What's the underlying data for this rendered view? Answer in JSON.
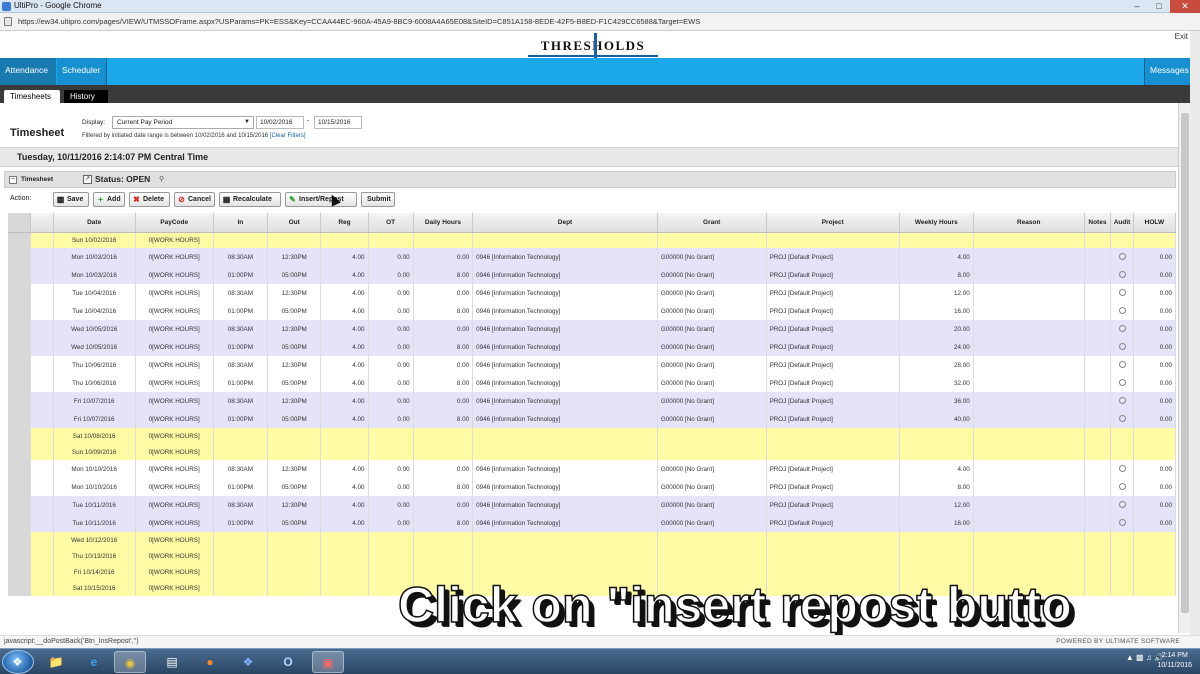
{
  "window": {
    "title": "UltiPro - Google Chrome",
    "url": "https://ew34.ultipro.com/pages/VIEW/UTMSSOFrame.aspx?USParams=PK=ESS&Key=CCAA44EC-960A-45A9-8BC9-6008A4A65E08&SiteID=C851A158-8EDE-42F5-B8ED-F1C429CC6588&Target=EWS"
  },
  "header": {
    "logo": "THRESHOLDS",
    "exit": "Exit"
  },
  "nav": {
    "attendance": "Attendance",
    "scheduler": "Scheduler",
    "messages": "Messages"
  },
  "tabs": {
    "timesheets": "Timesheets",
    "history": "History"
  },
  "filter": {
    "title": "Timesheet",
    "display_label": "Display:",
    "display_value": "Current Pay Period",
    "start": "10/02/2016",
    "end": "10/15/2016",
    "dash": "-",
    "note": "Filtered by initiated date range is between 10/02/2016 and 10/15/2016",
    "clear": "[Clear Filters]"
  },
  "dateline": "Tuesday, 10/11/2016 2:14:07 PM Central Time",
  "sheet": {
    "label": "Timesheet",
    "status": "Status: OPEN"
  },
  "actions": {
    "label": "Action:",
    "save": "Save",
    "add": "Add",
    "delete": "Delete",
    "cancel": "Cancel",
    "recalculate": "Recalculate",
    "insert_repost": "Insert/Repost",
    "submit": "Submit"
  },
  "columns": [
    "",
    "",
    "Date",
    "PayCode",
    "In",
    "Out",
    "Reg",
    "OT",
    "Daily Hours",
    "Dept",
    "Grant",
    "Project",
    "Weekly Hours",
    "Reason",
    "Notes",
    "Audit",
    "HOLW"
  ],
  "rows": [
    {
      "type": "yellow",
      "date": "Sun 10/02/2016",
      "paycode": "0[WORK HOURS]",
      "in": "",
      "out": "",
      "reg": "",
      "ot": "",
      "daily": "",
      "dept": "",
      "grant": "",
      "project": "",
      "weekly": "",
      "audit": false,
      "holw": ""
    },
    {
      "type": "purple",
      "date": "Mon 10/03/2016",
      "paycode": "0[WORK HOURS]",
      "in": "08:30AM",
      "out": "12:30PM",
      "reg": "4.00",
      "ot": "0.00",
      "daily": "0.00",
      "dept": "0946 [Information Technology]",
      "grant": "G00000 [No Grant]",
      "project": "PROJ [Default Project]",
      "weekly": "4.00",
      "audit": true,
      "holw": "0.00"
    },
    {
      "type": "purple",
      "date": "Mon 10/03/2016",
      "paycode": "0[WORK HOURS]",
      "in": "01:00PM",
      "out": "05:00PM",
      "reg": "4.00",
      "ot": "0.00",
      "daily": "8.00",
      "dept": "0946 [Information Technology]",
      "grant": "G00000 [No Grant]",
      "project": "PROJ [Default Project]",
      "weekly": "8.00",
      "audit": true,
      "holw": "0.00"
    },
    {
      "type": "white",
      "date": "Tue 10/04/2016",
      "paycode": "0[WORK HOURS]",
      "in": "08:30AM",
      "out": "12:30PM",
      "reg": "4.00",
      "ot": "0.00",
      "daily": "0.00",
      "dept": "0946 [Information Technology]",
      "grant": "G00000 [No Grant]",
      "project": "PROJ [Default Project]",
      "weekly": "12.00",
      "audit": true,
      "holw": "0.00"
    },
    {
      "type": "white",
      "date": "Tue 10/04/2016",
      "paycode": "0[WORK HOURS]",
      "in": "01:00PM",
      "out": "05:00PM",
      "reg": "4.00",
      "ot": "0.00",
      "daily": "8.00",
      "dept": "0946 [Information Technology]",
      "grant": "G00000 [No Grant]",
      "project": "PROJ [Default Project]",
      "weekly": "16.00",
      "audit": true,
      "holw": "0.00"
    },
    {
      "type": "purple",
      "date": "Wed 10/05/2016",
      "paycode": "0[WORK HOURS]",
      "in": "08:30AM",
      "out": "12:30PM",
      "reg": "4.00",
      "ot": "0.00",
      "daily": "0.00",
      "dept": "0946 [Information Technology]",
      "grant": "G00000 [No Grant]",
      "project": "PROJ [Default Project]",
      "weekly": "20.00",
      "audit": true,
      "holw": "0.00"
    },
    {
      "type": "purple",
      "date": "Wed 10/05/2016",
      "paycode": "0[WORK HOURS]",
      "in": "01:00PM",
      "out": "05:00PM",
      "reg": "4.00",
      "ot": "0.00",
      "daily": "8.00",
      "dept": "0946 [Information Technology]",
      "grant": "G00000 [No Grant]",
      "project": "PROJ [Default Project]",
      "weekly": "24.00",
      "audit": true,
      "holw": "0.00"
    },
    {
      "type": "white",
      "date": "Thu 10/06/2016",
      "paycode": "0[WORK HOURS]",
      "in": "08:30AM",
      "out": "12:30PM",
      "reg": "4.00",
      "ot": "0.00",
      "daily": "0.00",
      "dept": "0946 [Information Technology]",
      "grant": "G00000 [No Grant]",
      "project": "PROJ [Default Project]",
      "weekly": "28.00",
      "audit": true,
      "holw": "0.00"
    },
    {
      "type": "white",
      "date": "Thu 10/06/2016",
      "paycode": "0[WORK HOURS]",
      "in": "01:00PM",
      "out": "05:00PM",
      "reg": "4.00",
      "ot": "0.00",
      "daily": "8.00",
      "dept": "0946 [Information Technology]",
      "grant": "G00000 [No Grant]",
      "project": "PROJ [Default Project]",
      "weekly": "32.00",
      "audit": true,
      "holw": "0.00"
    },
    {
      "type": "purple",
      "date": "Fri 10/07/2016",
      "paycode": "0[WORK HOURS]",
      "in": "08:30AM",
      "out": "12:30PM",
      "reg": "4.00",
      "ot": "0.00",
      "daily": "0.00",
      "dept": "0946 [Information Technology]",
      "grant": "G00000 [No Grant]",
      "project": "PROJ [Default Project]",
      "weekly": "36.00",
      "audit": true,
      "holw": "0.00"
    },
    {
      "type": "purple",
      "date": "Fri 10/07/2016",
      "paycode": "0[WORK HOURS]",
      "in": "01:00PM",
      "out": "05:00PM",
      "reg": "4.00",
      "ot": "0.00",
      "daily": "8.00",
      "dept": "0946 [Information Technology]",
      "grant": "G00000 [No Grant]",
      "project": "PROJ [Default Project]",
      "weekly": "40.00",
      "audit": true,
      "holw": "0.00"
    },
    {
      "type": "yellow",
      "date": "Sat 10/08/2016",
      "paycode": "0[WORK HOURS]",
      "in": "",
      "out": "",
      "reg": "",
      "ot": "",
      "daily": "",
      "dept": "",
      "grant": "",
      "project": "",
      "weekly": "",
      "audit": false,
      "holw": ""
    },
    {
      "type": "yellow",
      "date": "Sun 10/09/2016",
      "paycode": "0[WORK HOURS]",
      "in": "",
      "out": "",
      "reg": "",
      "ot": "",
      "daily": "",
      "dept": "",
      "grant": "",
      "project": "",
      "weekly": "",
      "audit": false,
      "holw": ""
    },
    {
      "type": "white",
      "date": "Mon 10/10/2016",
      "paycode": "0[WORK HOURS]",
      "in": "08:30AM",
      "out": "12:30PM",
      "reg": "4.00",
      "ot": "0.00",
      "daily": "0.00",
      "dept": "0946 [Information Technology]",
      "grant": "G00000 [No Grant]",
      "project": "PROJ [Default Project]",
      "weekly": "4.00",
      "audit": true,
      "holw": "0.00"
    },
    {
      "type": "white",
      "date": "Mon 10/10/2016",
      "paycode": "0[WORK HOURS]",
      "in": "01:00PM",
      "out": "05:00PM",
      "reg": "4.00",
      "ot": "0.00",
      "daily": "8.00",
      "dept": "0946 [Information Technology]",
      "grant": "G00000 [No Grant]",
      "project": "PROJ [Default Project]",
      "weekly": "8.00",
      "audit": true,
      "holw": "0.00"
    },
    {
      "type": "purple",
      "date": "Tue 10/11/2016",
      "paycode": "0[WORK HOURS]",
      "in": "08:30AM",
      "out": "12:30PM",
      "reg": "4.00",
      "ot": "0.00",
      "daily": "0.00",
      "dept": "0946 [Information Technology]",
      "grant": "G00000 [No Grant]",
      "project": "PROJ [Default Project]",
      "weekly": "12.00",
      "audit": true,
      "holw": "0.00"
    },
    {
      "type": "purple",
      "date": "Tue 10/11/2016",
      "paycode": "0[WORK HOURS]",
      "in": "01:00PM",
      "out": "05:00PM",
      "reg": "4.00",
      "ot": "0.00",
      "daily": "8.00",
      "dept": "0946 [Information Technology]",
      "grant": "G00000 [No Grant]",
      "project": "PROJ [Default Project]",
      "weekly": "16.00",
      "audit": true,
      "holw": "0.00"
    },
    {
      "type": "yellow",
      "date": "Wed 10/12/2016",
      "paycode": "0[WORK HOURS]",
      "in": "",
      "out": "",
      "reg": "",
      "ot": "",
      "daily": "",
      "dept": "",
      "grant": "",
      "project": "",
      "weekly": "",
      "audit": false,
      "holw": ""
    },
    {
      "type": "yellow",
      "date": "Thu 10/13/2016",
      "paycode": "0[WORK HOURS]",
      "in": "",
      "out": "",
      "reg": "",
      "ot": "",
      "daily": "",
      "dept": "",
      "grant": "",
      "project": "",
      "weekly": "",
      "audit": false,
      "holw": ""
    },
    {
      "type": "yellow",
      "date": "Fri 10/14/2016",
      "paycode": "0[WORK HOURS]",
      "in": "",
      "out": "",
      "reg": "",
      "ot": "",
      "daily": "",
      "dept": "",
      "grant": "",
      "project": "",
      "weekly": "",
      "audit": false,
      "holw": ""
    },
    {
      "type": "yellow",
      "date": "Sat 10/15/2016",
      "paycode": "0[WORK HOURS]",
      "in": "",
      "out": "",
      "reg": "",
      "ot": "",
      "daily": "",
      "dept": "",
      "grant": "",
      "project": "",
      "weekly": "",
      "audit": false,
      "holw": ""
    }
  ],
  "statusbar": {
    "js": "javascript:__doPostBack('Btn_InsRepost','')",
    "powered": "POWERED BY ULTIMATE SOFTWARE"
  },
  "caption": "Click on \"insert repost butto",
  "taskbar": {
    "time": "2:14 PM",
    "date": "10/11/2016",
    "icons": [
      "windows-start-icon",
      "explorer-folder-icon",
      "internet-explorer-icon",
      "chrome-icon",
      "network-icon",
      "firefox-icon",
      "teamviewer-icon",
      "outlook-icon",
      "media-icon"
    ]
  },
  "colors": {
    "nav": "#1ba7ea",
    "yellow_row": "#fffba4",
    "purple_row": "#e4e3f8"
  }
}
